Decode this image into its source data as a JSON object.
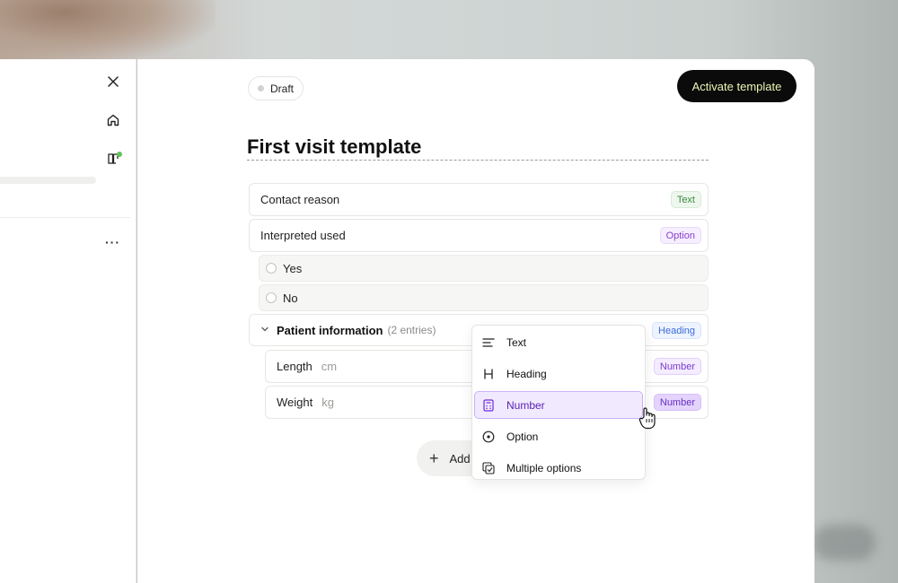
{
  "sidebar": {
    "icons": [
      "close-icon",
      "home-icon",
      "book-icon",
      "more-icon"
    ],
    "notification_color": "#63c15b"
  },
  "header": {
    "status": "Draft",
    "activate_label": "Activate template"
  },
  "template": {
    "title": "First visit template",
    "fields": [
      {
        "label": "Contact reason",
        "type": "Text"
      },
      {
        "label": "Interpreted used",
        "type": "Option",
        "options": [
          "Yes",
          "No"
        ]
      }
    ],
    "section": {
      "label": "Patient information",
      "count": "(2 entries)",
      "type": "Heading",
      "entries": [
        {
          "label": "Length",
          "unit": "cm",
          "type": "Number"
        },
        {
          "label": "Weight",
          "unit": "kg",
          "type": "Number"
        }
      ]
    },
    "add_label": "Add"
  },
  "menu": {
    "items": [
      {
        "label": "Text",
        "icon": "text-lines-icon"
      },
      {
        "label": "Heading",
        "icon": "heading-icon"
      },
      {
        "label": "Number",
        "icon": "calculator-icon",
        "selected": true
      },
      {
        "label": "Option",
        "icon": "radio-icon"
      },
      {
        "label": "Multiple options",
        "icon": "checkbox-stack-icon"
      }
    ]
  },
  "colors": {
    "accent": "#7c3aed",
    "activate_text": "#e9f7b5",
    "text_tag": "#3a8a3f",
    "option_tag": "#8a3ecf",
    "heading_tag": "#3b6bd8"
  }
}
